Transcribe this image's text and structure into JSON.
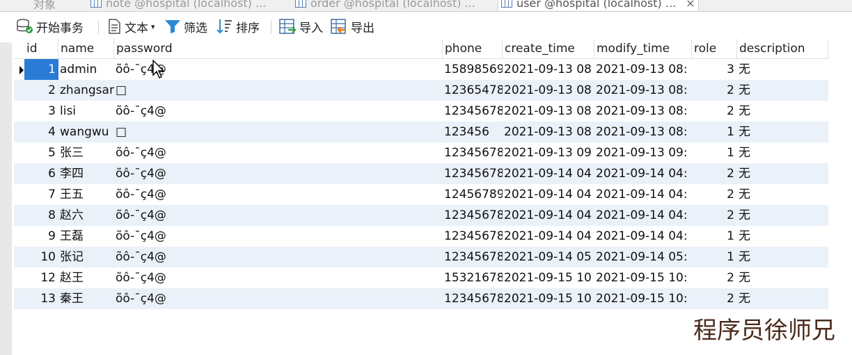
{
  "tabs": [
    {
      "label": "对象"
    },
    {
      "label": "note @hospital (localhost) ..."
    },
    {
      "label": "order @hospital (localhost) ..."
    },
    {
      "label": "user @hospital (localhost) ...",
      "active": true
    }
  ],
  "toolbar": {
    "begin_transaction": "开始事务",
    "text": "文本",
    "filter": "筛选",
    "sort": "排序",
    "import": "导入",
    "export": "导出"
  },
  "table": {
    "columns": [
      "id",
      "name",
      "password",
      "phone",
      "create_time",
      "modify_time",
      "role",
      "description"
    ],
    "rows": [
      {
        "id": "1",
        "name": "admin",
        "password": "õô-¯ç4@",
        "phone": "15898569",
        "create_time": "2021-09-13 08",
        "modify_time": "2021-09-13 08:",
        "role": "3",
        "description": "无"
      },
      {
        "id": "2",
        "name": "zhangsan",
        "password": "□",
        "phone": "12365478",
        "create_time": "2021-09-13 08",
        "modify_time": "2021-09-13 08:",
        "role": "2",
        "description": "无"
      },
      {
        "id": "3",
        "name": "lisi",
        "password": "õô-¯ç4@",
        "phone": "12345678",
        "create_time": "2021-09-13 08",
        "modify_time": "2021-09-13 08:",
        "role": "2",
        "description": "无"
      },
      {
        "id": "4",
        "name": "wangwu",
        "password": "□",
        "phone": "123456",
        "create_time": "2021-09-13 08",
        "modify_time": "2021-09-13 08:",
        "role": "1",
        "description": "无"
      },
      {
        "id": "5",
        "name": "张三",
        "password": "õô-¯ç4@",
        "phone": "12345678",
        "create_time": "2021-09-13 09",
        "modify_time": "2021-09-13 09:",
        "role": "1",
        "description": "无"
      },
      {
        "id": "6",
        "name": "李四",
        "password": "õô-¯ç4@",
        "phone": "12345678",
        "create_time": "2021-09-14 04",
        "modify_time": "2021-09-14 04:",
        "role": "2",
        "description": "无"
      },
      {
        "id": "7",
        "name": "王五",
        "password": "õô-¯ç4@",
        "phone": "12456789",
        "create_time": "2021-09-14 04",
        "modify_time": "2021-09-14 04:",
        "role": "2",
        "description": "无"
      },
      {
        "id": "8",
        "name": "赵六",
        "password": "õô-¯ç4@",
        "phone": "12345678",
        "create_time": "2021-09-14 04",
        "modify_time": "2021-09-14 04:",
        "role": "2",
        "description": "无"
      },
      {
        "id": "9",
        "name": "王磊",
        "password": "õô-¯ç4@",
        "phone": "12345678",
        "create_time": "2021-09-14 04",
        "modify_time": "2021-09-14 04:",
        "role": "1",
        "description": "无"
      },
      {
        "id": "10",
        "name": "张记",
        "password": "õô-¯ç4@",
        "phone": "12345678",
        "create_time": "2021-09-14 05",
        "modify_time": "2021-09-14 05:",
        "role": "1",
        "description": "无"
      },
      {
        "id": "12",
        "name": "赵王",
        "password": "õô-¯ç4@",
        "phone": "15321678",
        "create_time": "2021-09-15 10",
        "modify_time": "2021-09-15 10:",
        "role": "2",
        "description": "无"
      },
      {
        "id": "13",
        "name": "秦王",
        "password": "õô-¯ç4@",
        "phone": "12345678",
        "create_time": "2021-09-15 10",
        "modify_time": "2021-09-15 10:",
        "role": "2",
        "description": "无"
      }
    ]
  },
  "watermark": "程序员徐师兄",
  "colors": {
    "selected": "#2a7bd6",
    "alt_row": "#eaf1f8"
  }
}
